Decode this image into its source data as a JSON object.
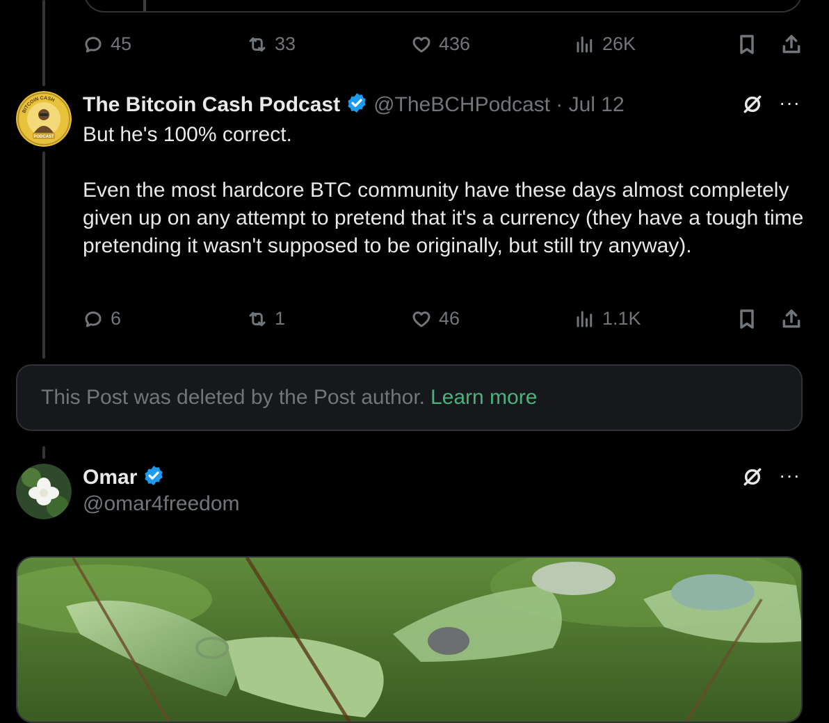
{
  "first_post": {
    "replies": "45",
    "reposts": "33",
    "likes": "436",
    "views": "26K"
  },
  "bch_post": {
    "author_name": "The Bitcoin Cash Podcast",
    "handle_date": "@TheBCHPodcast · Jul 12",
    "avatar_text": "BITCOIN CASH PODCAST",
    "text": "But he's 100% correct.\n\nEven the most hardcore BTC community have these days almost completely given up on any attempt to pretend that it's a currency (they have a tough time pretending it wasn't supposed to be originally, but still try anyway).",
    "replies": "6",
    "reposts": "1",
    "likes": "46",
    "views": "1.1K"
  },
  "deleted_notice": {
    "text": "This Post was deleted by the Post author.",
    "link": "Learn more"
  },
  "omar_post": {
    "author_name": "Omar",
    "handle": "@omar4freedom"
  },
  "icons": {
    "reply": "reply-icon",
    "repost": "repost-icon",
    "like": "heart-icon",
    "views": "views-icon",
    "bookmark": "bookmark-icon",
    "share": "share-icon",
    "grok": "grok-icon",
    "more": "more-icon",
    "verified": "verified-icon"
  },
  "colors": {
    "background": "#000000",
    "text_primary": "#e7e9ea",
    "text_secondary": "#71767b",
    "verified": "#1d9bf0",
    "link": "#4ab27c"
  }
}
